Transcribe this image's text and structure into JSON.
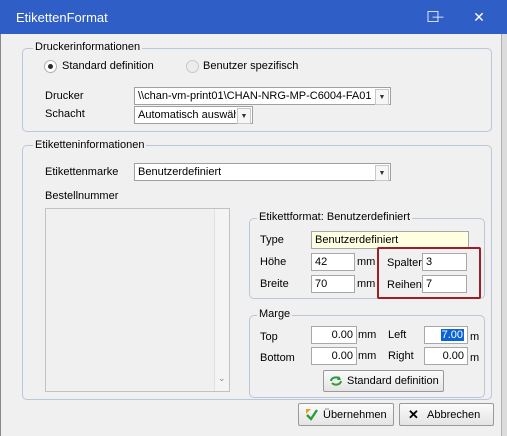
{
  "window": {
    "title": "EtikettenFormat",
    "minimize": "—",
    "maximize": "☐",
    "close": "✕"
  },
  "printer_group": {
    "legend": "Druckerinformationen",
    "radio_standard": "Standard definition",
    "radio_custom": "Benutzer spezifisch",
    "printer_label": "Drucker",
    "printer_value": "\\\\chan-vm-print01\\CHAN-NRG-MP-C6004-FA01",
    "tray_label": "Schacht",
    "tray_value": "Automatisch auswähl"
  },
  "label_group": {
    "legend": "Etiketteninformationen",
    "brand_label": "Etikettenmarke",
    "brand_value": "Benutzerdefiniert",
    "order_label": "Bestellnummer"
  },
  "format_group": {
    "legend": "Etikettformat: Benutzerdefiniert",
    "type_label": "Type",
    "type_value": "Benutzerdefiniert",
    "height_label": "Höhe",
    "height_value": "42",
    "height_unit": "mm",
    "width_label": "Breite",
    "width_value": "70",
    "width_unit": "mm",
    "columns_label": "Spalter",
    "columns_value": "3",
    "rows_label": "Reihen",
    "rows_value": "7"
  },
  "margin_group": {
    "legend": "Marge",
    "top_label": "Top",
    "top_value": "0.00",
    "top_unit": "mm",
    "bottom_label": "Bottom",
    "bottom_value": "0.00",
    "bottom_unit": "mm",
    "left_label": "Left",
    "left_value": "7.00",
    "left_unit": "m",
    "right_label": "Right",
    "right_value": "0.00",
    "right_unit": "m",
    "standard_button": "Standard definition"
  },
  "footer": {
    "apply_button": "Übernehmen",
    "cancel_button": "Abbrechen"
  },
  "colors": {
    "titlebar": "#2f5fc6",
    "type_field_bg": "#ffffe1",
    "highlight_box": "#9b1f27",
    "selection": "#0a64d8"
  }
}
